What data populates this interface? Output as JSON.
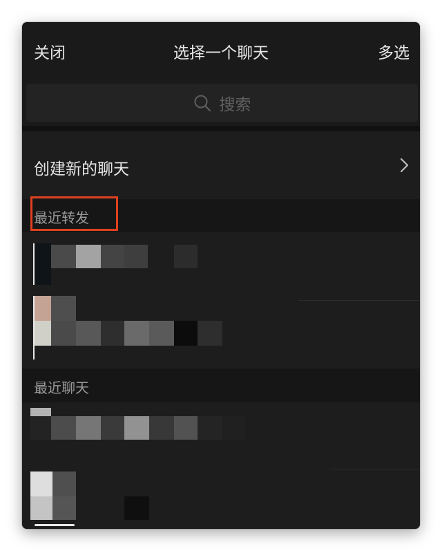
{
  "header": {
    "close_label": "关闭",
    "title": "选择一个聊天",
    "multi_select_label": "多选"
  },
  "search": {
    "placeholder": "搜索",
    "icon": "search-icon"
  },
  "create_chat": {
    "label": "创建新的聊天",
    "icon": "chevron-right-icon"
  },
  "sections": {
    "recent_forward": "最近转发",
    "recent_chats": "最近聊天"
  },
  "colors": {
    "background": "#1a1a1a",
    "highlight": "#e0401f"
  }
}
